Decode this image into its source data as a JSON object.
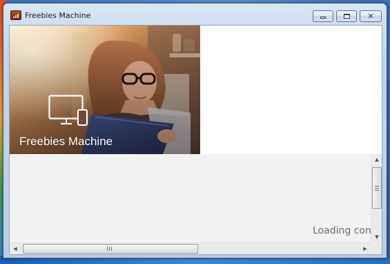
{
  "window": {
    "title": "Freebies Machine",
    "icons": {
      "app": "app-icon",
      "minimize": "minimize-icon",
      "maximize": "maximize-icon",
      "close": "close-icon"
    }
  },
  "hero": {
    "label": "Freebies Machine",
    "icon": "monitor-icon"
  },
  "content": {
    "loading_text": "Loading content..."
  },
  "scrollbars": {
    "vertical": {
      "up_icon": "scroll-up-icon",
      "down_icon": "scroll-down-icon"
    },
    "horizontal": {
      "left_icon": "scroll-left-icon",
      "right_icon": "scroll-right-icon"
    }
  },
  "colors": {
    "client_background": "#f2f2f2",
    "loading_text": "#6d6d6d",
    "hero_label": "#ffffff"
  }
}
